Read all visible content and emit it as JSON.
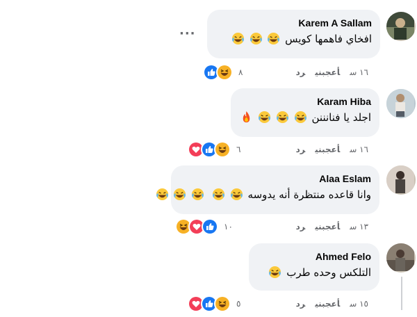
{
  "comments": [
    {
      "author": "Karem A Sallam",
      "text": "افخاي فاهمها كويس",
      "emoji_count": 3,
      "time": "١٦ س",
      "like_label": "أعجبني",
      "reply_label": "رد",
      "reaction_count": "٨",
      "reactions": [
        "haha-icon",
        "like-icon"
      ]
    },
    {
      "author": "Karam Hiba",
      "text": "اجلد يا فنانننن",
      "emoji_count": 3,
      "time": "١٦ س",
      "like_label": "أعجبني",
      "reply_label": "رد",
      "reaction_count": "٦",
      "reactions": [
        "haha-icon",
        "like-icon",
        "love-icon"
      ]
    },
    {
      "author": "Alaa Eslam",
      "text": "وانا قاعده منتظرة أنه يدوسه",
      "emoji_count": 5,
      "time": "١٣ س",
      "like_label": "أعجبني",
      "reply_label": "رد",
      "reaction_count": "١٠",
      "reactions": [
        "like-icon",
        "love-icon",
        "haha-icon"
      ]
    },
    {
      "author": "Ahmed Felo",
      "text": "التلكس وحده طرب",
      "emoji_count": 1,
      "time": "١٥ س",
      "like_label": "أعجبني",
      "reply_label": "رد",
      "reaction_count": "٥",
      "reactions": [
        "haha-icon",
        "like-icon",
        "love-icon"
      ]
    }
  ],
  "more_options": "···",
  "colors": {
    "bubble": "#f0f2f5",
    "meta_text": "#65676b",
    "like_blue": "#1877f2",
    "love_red": "#f33e58",
    "haha_yellow": "#f7b125"
  }
}
